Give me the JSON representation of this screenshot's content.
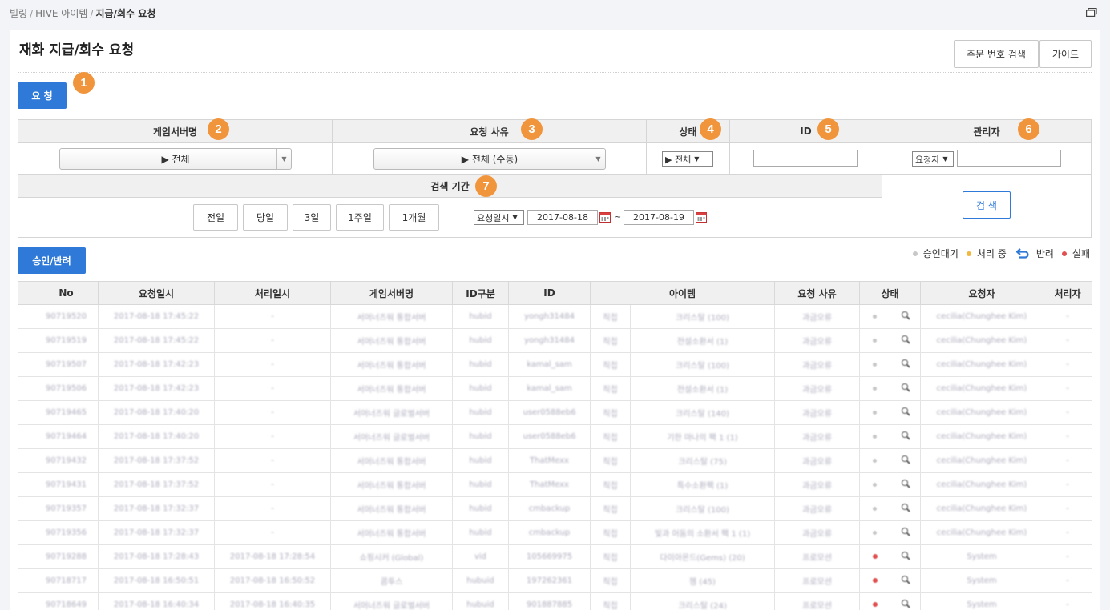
{
  "breadcrumb": {
    "part1": "빌링",
    "part2": "HIVE 아이템",
    "current": "지급/회수 요청",
    "sep": "/"
  },
  "page": {
    "title": "재화 지급/회수 요청"
  },
  "header_buttons": {
    "order_search": "주문 번호 검색",
    "guide": "가이드"
  },
  "request_button": "요 청",
  "approve_button": "승인/반려",
  "badges": [
    "1",
    "2",
    "3",
    "4",
    "5",
    "6",
    "7"
  ],
  "filters": {
    "game_server": {
      "label": "게임서버명",
      "value": "▶ 전체"
    },
    "reason": {
      "label": "요청 사유",
      "value": "▶ 전체 (수동)"
    },
    "status": {
      "label": "상태",
      "value": "▶ 전체"
    },
    "id": {
      "label": "ID",
      "value": ""
    },
    "admin": {
      "label": "관리자",
      "value": "요청자",
      "text": ""
    },
    "period": {
      "label": "검색 기간",
      "buttons": [
        "전일",
        "당일",
        "3일",
        "1주일",
        "1개월"
      ],
      "date_type": "요청일시",
      "from": "2017-08-18",
      "tilde": "~",
      "to": "2017-08-19"
    },
    "search_button": "검 색"
  },
  "legend": {
    "waiting": "승인대기",
    "processing": "처리 중",
    "returned": "반려",
    "failed": "실패"
  },
  "colors": {
    "accent": "#2f7ad8",
    "badge": "#f0953c",
    "waiting": "#c8c8c8",
    "processing": "#f0b83c",
    "failed": "#e05050"
  },
  "table": {
    "headers": [
      "",
      "No",
      "요청일시",
      "처리일시",
      "게임서버명",
      "ID구분",
      "ID",
      "아이템",
      "요청 사유",
      "상태",
      "요청자",
      "처리자"
    ],
    "rows": [
      [
        "",
        "90719520",
        "2017-08-18 17:45:22",
        "-",
        "서머너즈워 통합서버",
        "hubid",
        "yongh31484",
        "직접",
        "크리스탈 (100)",
        "과금오류",
        "cecilia(Chunghee Kim)",
        "-",
        "gray"
      ],
      [
        "",
        "90719519",
        "2017-08-18 17:45:22",
        "-",
        "서머너즈워 통합서버",
        "hubid",
        "yongh31484",
        "직접",
        "전설소환서 (1)",
        "과금오류",
        "cecilia(Chunghee Kim)",
        "-",
        "gray"
      ],
      [
        "",
        "90719507",
        "2017-08-18 17:42:23",
        "-",
        "서머너즈워 통합서버",
        "hubid",
        "kamal_sam",
        "직접",
        "크리스탈 (100)",
        "과금오류",
        "cecilia(Chunghee Kim)",
        "-",
        "gray"
      ],
      [
        "",
        "90719506",
        "2017-08-18 17:42:23",
        "-",
        "서머너즈워 통합서버",
        "hubid",
        "kamal_sam",
        "직접",
        "전설소환서 (1)",
        "과금오류",
        "cecilia(Chunghee Kim)",
        "-",
        "gray"
      ],
      [
        "",
        "90719465",
        "2017-08-18 17:40:20",
        "-",
        "서머너즈워 글로벌서버",
        "hubid",
        "user0588eb6",
        "직접",
        "크리스탈 (140)",
        "과금오류",
        "cecilia(Chunghee Kim)",
        "-",
        "gray"
      ],
      [
        "",
        "90719464",
        "2017-08-18 17:40:20",
        "-",
        "서머너즈워 글로벌서버",
        "hubid",
        "user0588eb6",
        "직접",
        "기한 마나의 팩 1 (1)",
        "과금오류",
        "cecilia(Chunghee Kim)",
        "-",
        "gray"
      ],
      [
        "",
        "90719432",
        "2017-08-18 17:37:52",
        "-",
        "서머너즈워 통합서버",
        "hubid",
        "ThatMexx",
        "직접",
        "크리스탈 (75)",
        "과금오류",
        "cecilia(Chunghee Kim)",
        "-",
        "gray"
      ],
      [
        "",
        "90719431",
        "2017-08-18 17:37:52",
        "-",
        "서머너즈워 통합서버",
        "hubid",
        "ThatMexx",
        "직접",
        "특수소환팩 (1)",
        "과금오류",
        "cecilia(Chunghee Kim)",
        "-",
        "gray"
      ],
      [
        "",
        "90719357",
        "2017-08-18 17:32:37",
        "-",
        "서머너즈워 통합서버",
        "hubid",
        "cmbackup",
        "직접",
        "크리스탈 (100)",
        "과금오류",
        "cecilia(Chunghee Kim)",
        "-",
        "gray"
      ],
      [
        "",
        "90719356",
        "2017-08-18 17:32:37",
        "-",
        "서머너즈워 통합서버",
        "hubid",
        "cmbackup",
        "직접",
        "빛과 어둠의 소환서 팩 1 (1)",
        "과금오류",
        "cecilia(Chunghee Kim)",
        "-",
        "gray"
      ],
      [
        "",
        "90719288",
        "2017-08-18 17:28:43",
        "2017-08-18 17:28:54",
        "쇼핑시커 (Global)",
        "vid",
        "105669975",
        "직접",
        "다이아몬드(Gems) (20)",
        "프로모션",
        "System",
        "-",
        "red"
      ],
      [
        "",
        "90718717",
        "2017-08-18 16:50:51",
        "2017-08-18 16:50:52",
        "콤투스",
        "hubuid",
        "197262361",
        "직접",
        "젬 (45)",
        "프로모션",
        "System",
        "-",
        "red"
      ],
      [
        "",
        "90718649",
        "2017-08-18 16:40:34",
        "2017-08-18 16:40:35",
        "서머너즈워 글로벌서버",
        "hubuid",
        "901887885",
        "직접",
        "크리스탈 (24)",
        "프로모션",
        "System",
        "-",
        "red"
      ]
    ]
  }
}
